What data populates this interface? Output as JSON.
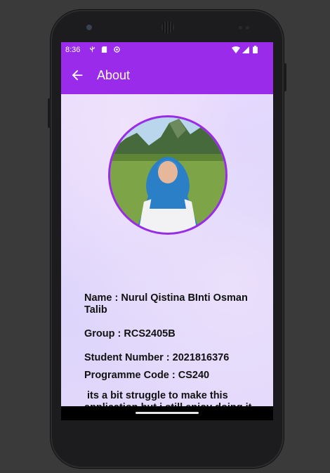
{
  "status_bar": {
    "time": "8:36",
    "icons": [
      "usb-icon",
      "sd-card-icon",
      "sync-icon",
      "wifi-icon",
      "signal-icon",
      "battery-icon"
    ]
  },
  "app_bar": {
    "back_icon": "arrow-back-icon",
    "title": "About",
    "color": "#9b2bea"
  },
  "profile": {
    "photo": "profile-photo",
    "border_color": "#9b2bea"
  },
  "info": {
    "name": "Name : Nurul Qistina BInti Osman Talib",
    "group": "Group : RCS2405B",
    "student_number": "Student Number : 2021816376",
    "programme_code": "Programme Code : CS240",
    "note": " its a bit struggle to make this application but i still enjoy doing it and learn many new thing"
  }
}
